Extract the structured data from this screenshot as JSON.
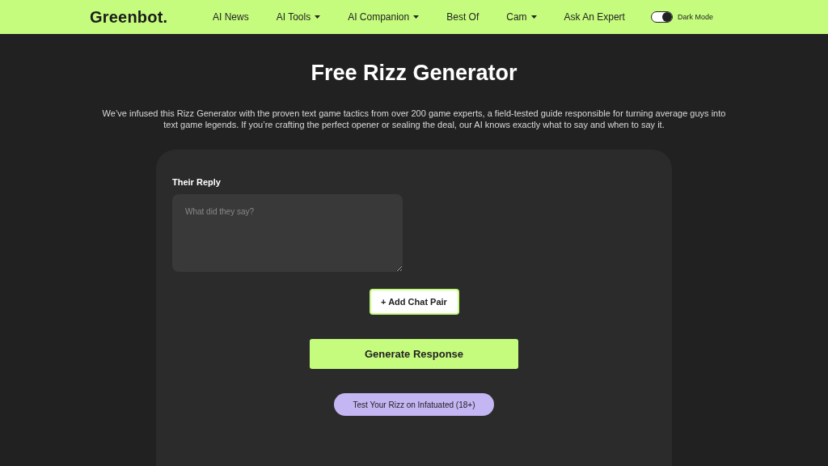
{
  "header": {
    "logo": "Greenbot.",
    "nav": [
      {
        "label": "AI News",
        "dropdown": false
      },
      {
        "label": "AI Tools",
        "dropdown": true
      },
      {
        "label": "AI Companion",
        "dropdown": true
      },
      {
        "label": "Best Of",
        "dropdown": false
      },
      {
        "label": "Cam",
        "dropdown": true
      },
      {
        "label": "Ask An Expert",
        "dropdown": false
      }
    ],
    "dark_mode": {
      "label": "Dark Mode",
      "on": true
    }
  },
  "title": "Free Rizz Generator",
  "intro": "We’ve infused this Rizz Generator with the proven text game tactics from over 200 game experts, a field-tested guide responsible for turning average guys into text game legends. If you’re crafting the perfect opener or sealing the deal, our AI knows exactly what to say and when to say it.",
  "form": {
    "field_label": "Their Reply",
    "placeholder": "What did they say?",
    "add_button": "+ Add Chat Pair",
    "generate_button": "Generate Response",
    "test_button": "Test Your Rizz on Infatuated (18+)"
  }
}
